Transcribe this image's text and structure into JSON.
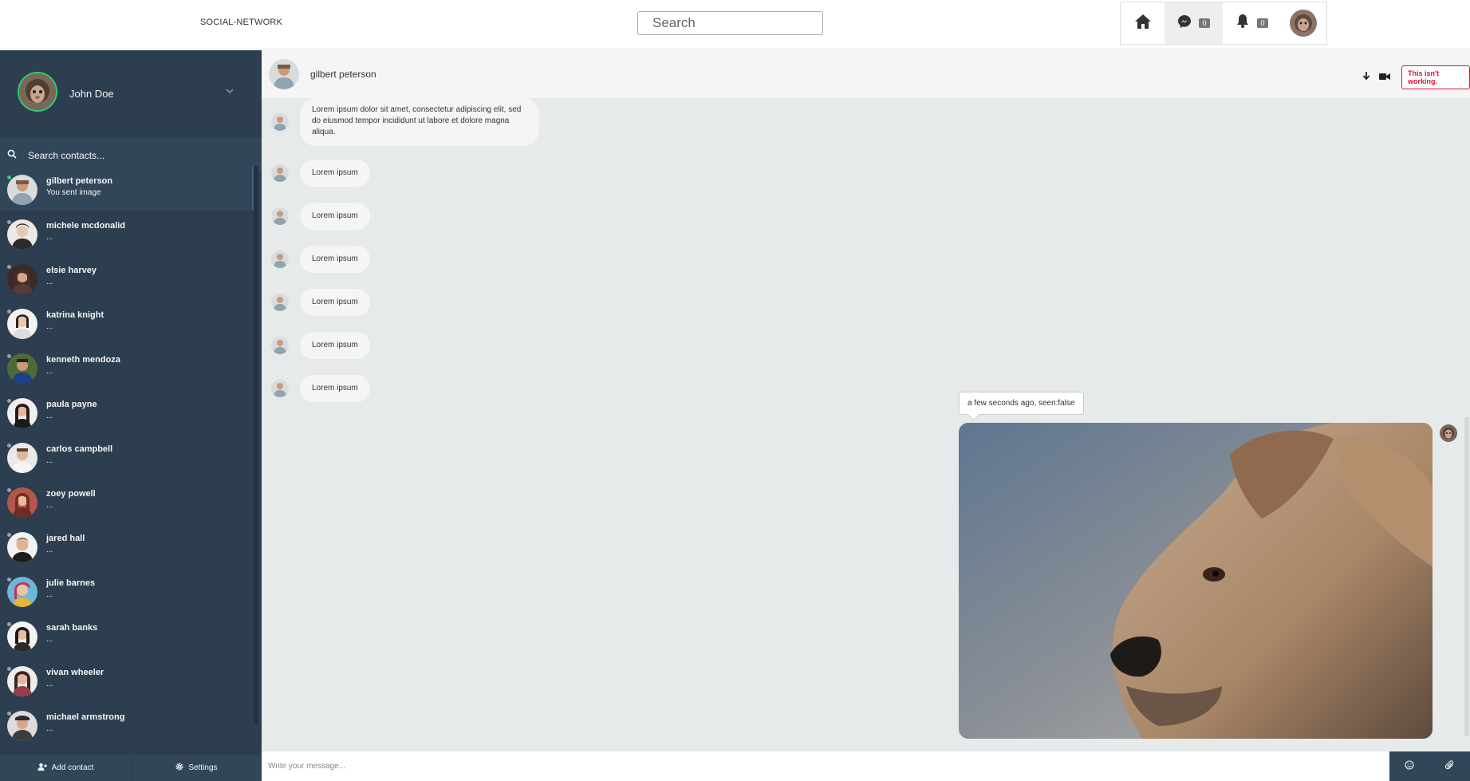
{
  "navbar": {
    "brand": "SOCIAL-NETWORK",
    "search_placeholder": "Search",
    "messages_count": "0",
    "notifications_count": "0"
  },
  "sidebar": {
    "user_name": "John Doe",
    "search_placeholder": "Search contacts...",
    "contacts": [
      {
        "name": "gilbert peterson",
        "preview": "You sent image",
        "online": true,
        "active": true
      },
      {
        "name": "michele mcdonalid",
        "preview": "...",
        "online": false
      },
      {
        "name": "elsie harvey",
        "preview": "...",
        "online": false
      },
      {
        "name": "katrina knight",
        "preview": "...",
        "online": false
      },
      {
        "name": "kenneth mendoza",
        "preview": "...",
        "online": false
      },
      {
        "name": "paula payne",
        "preview": "...",
        "online": false
      },
      {
        "name": "carlos campbell",
        "preview": "...",
        "online": false
      },
      {
        "name": "zoey powell",
        "preview": "...",
        "online": false
      },
      {
        "name": "jared hall",
        "preview": "...",
        "online": false
      },
      {
        "name": "julie barnes",
        "preview": "...",
        "online": false
      },
      {
        "name": "sarah banks",
        "preview": "...",
        "online": false
      },
      {
        "name": "vivan wheeler",
        "preview": "...",
        "online": false
      },
      {
        "name": "michael armstrong",
        "preview": "...",
        "online": false
      }
    ],
    "add_contact_label": "Add contact",
    "settings_label": "Settings"
  },
  "chat": {
    "contact_name": "gilbert peterson",
    "error_tooltip": "This isn't working.",
    "messages": [
      {
        "text": "Lorem ipsum dolor sit amet, consectetur adipiscing elit, sed do eiusmod tempor incididunt ut labore et dolore magna aliqua."
      },
      {
        "text": "Lorem ipsum"
      },
      {
        "text": "Lorem ipsum"
      },
      {
        "text": "Lorem ipsum"
      },
      {
        "text": "Lorem ipsum"
      },
      {
        "text": "Lorem ipsum"
      },
      {
        "text": "Lorem ipsum"
      }
    ],
    "sent_image_tooltip": "a few seconds ago, seen:false",
    "composer_placeholder": "Write your message..."
  },
  "icons": {
    "home": "home-icon",
    "messenger": "messenger-icon",
    "bell": "bell-icon",
    "caret": "chevron-down-icon",
    "search": "search-icon",
    "arrow_down": "arrow-down-icon",
    "video": "video-camera-icon",
    "user_plus": "user-plus-icon",
    "gear": "gear-icon",
    "smile": "smile-icon",
    "paperclip": "paperclip-icon"
  },
  "colors": {
    "sidebar_bg": "#2c3e50",
    "sidebar_panel": "#32465a",
    "online": "#2ecc71",
    "chat_bg": "#e6eaea",
    "error": "#d01a3a"
  }
}
